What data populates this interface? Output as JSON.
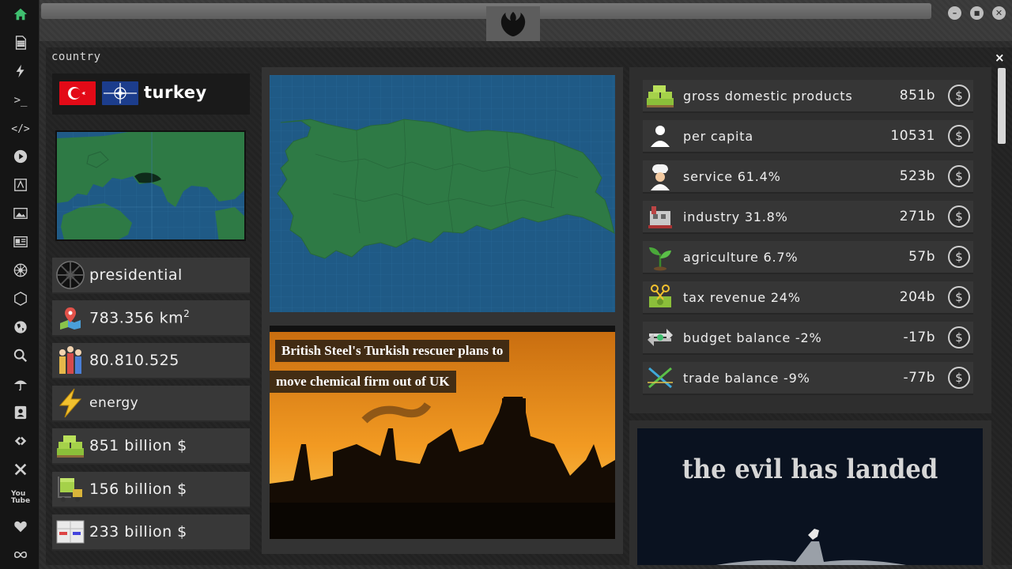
{
  "window": {
    "minimize": "–",
    "maximize": "■",
    "close": "✕"
  },
  "panel": {
    "title": "country",
    "close": "×"
  },
  "sidebar": {
    "icons": [
      "home-icon",
      "document-icon",
      "lightning-icon",
      "terminal-icon",
      "code-icon",
      "play-icon",
      "translate-icon",
      "image-icon",
      "news-icon",
      "empire-icon",
      "hexagon-icon",
      "globe-icon",
      "search-icon",
      "umbrella-icon",
      "contact-icon",
      "exchange-icon",
      "tools-icon",
      "youtube-icon",
      "heart-icon",
      "infinity-icon"
    ]
  },
  "country": {
    "name": "turkey",
    "government": "presidential",
    "area_value": "783.356 km",
    "area_sup": "2",
    "population": "80.810.525",
    "resource": "energy",
    "gdp": "851 billion $",
    "trade_value_1": "156 billion $",
    "trade_value_2": "233 billion $"
  },
  "news": {
    "headline_line1": "British Steel's Turkish rescuer plans to",
    "headline_line2": "move chemical firm out of UK"
  },
  "economy": {
    "rows": [
      {
        "label": "gross domestic products",
        "value": "851b",
        "icon": "money-stack-icon"
      },
      {
        "label": "per capita",
        "value": "10531",
        "icon": "person-icon"
      },
      {
        "label": "service 61.4%",
        "value": "523b",
        "icon": "chef-icon"
      },
      {
        "label": "industry 31.8%",
        "value": "271b",
        "icon": "factory-icon"
      },
      {
        "label": "agriculture 6.7%",
        "value": "57b",
        "icon": "plant-icon"
      },
      {
        "label": "tax revenue 24%",
        "value": "204b",
        "icon": "scissors-money-icon"
      },
      {
        "label": "budget balance -2%",
        "value": "-17b",
        "icon": "arrows-icon"
      },
      {
        "label": "trade balance -9%",
        "value": "-77b",
        "icon": "cross-arrows-icon"
      }
    ],
    "coin_symbol": "$"
  },
  "promo": {
    "text": "the evil has landed"
  },
  "colors": {
    "map_water": "#1f5a86",
    "map_land": "#2e7a45",
    "turkey_red": "#e30a17"
  }
}
